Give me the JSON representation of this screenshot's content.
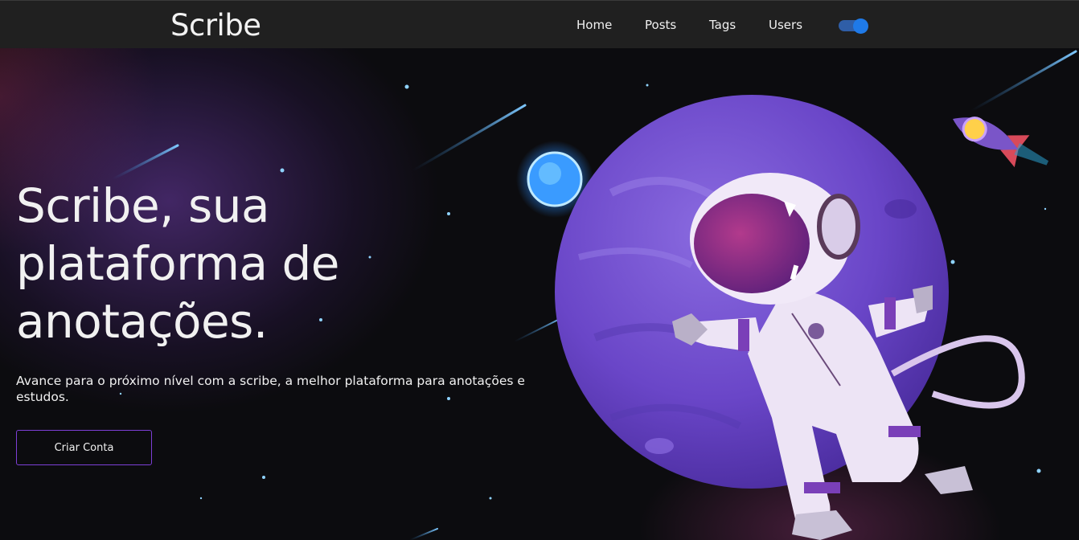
{
  "navbar": {
    "brand": "Scribe",
    "links": [
      {
        "label": "Home"
      },
      {
        "label": "Posts"
      },
      {
        "label": "Tags"
      },
      {
        "label": "Users"
      }
    ],
    "theme_toggle": {
      "on": true
    }
  },
  "hero": {
    "title": "Scribe, sua plataforma de anotações.",
    "description": "Avance para o próximo nível com a scribe, a melhor plataforma para anotações e estudos.",
    "cta_label": "Criar Conta"
  },
  "colors": {
    "navbar_bg": "#202020",
    "page_bg": "#0c0c0f",
    "accent_border": "#7d3fd6",
    "toggle_blue": "#1f7ae8",
    "planet": "#6a46c8"
  },
  "illustration": {
    "subject": "astronaut-floating-in-space",
    "elements": [
      "purple-planet",
      "blue-small-planet",
      "rocket-icon",
      "stars",
      "meteors"
    ]
  }
}
